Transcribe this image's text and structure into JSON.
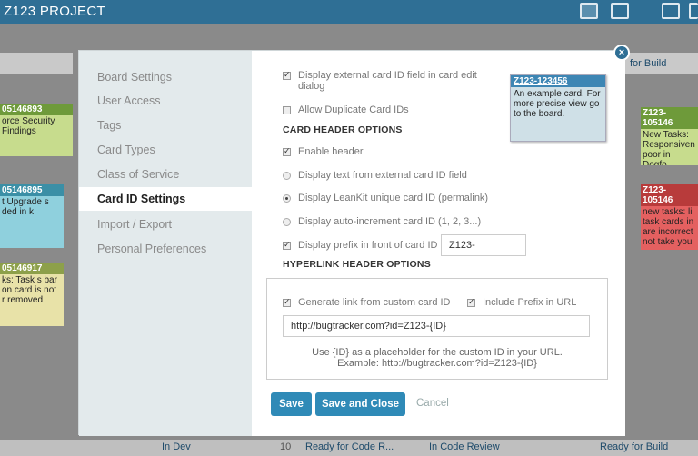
{
  "app": {
    "title": "Z123 PROJECT"
  },
  "board": {
    "lanes_top": [
      "for Build"
    ],
    "cards_left": [
      {
        "id": "05146893",
        "text": "orce Security Findings"
      },
      {
        "id": "05146895",
        "text": "t Upgrade s ded in k"
      },
      {
        "id": "05146917",
        "text": "ks: Task s bar on card is not r removed"
      }
    ],
    "cards_right": [
      {
        "id": "Z123-105146",
        "text": "New Tasks: Responsiven poor in Dogfo"
      },
      {
        "id": "Z123-105146",
        "text": "new tasks: li task cards in are incorrect not take you"
      }
    ],
    "bottom_lanes": [
      "In Dev",
      "10",
      "Ready for Code R...",
      "In Code Review",
      "Ready for Build"
    ],
    "colors": {
      "topbar": "#2f6f95",
      "card_green": "#c7dc8d",
      "card_blue": "#8fd0dd",
      "card_yellow": "#e8e2a8",
      "card_red": "#e46060"
    }
  },
  "modal": {
    "sidebar": [
      {
        "label": "Board Settings"
      },
      {
        "label": "User Access"
      },
      {
        "label": "Tags"
      },
      {
        "label": "Card Types"
      },
      {
        "label": "Class of Service"
      },
      {
        "label": "Card ID Settings",
        "active": true
      },
      {
        "label": "Import / Export"
      },
      {
        "label": "Personal Preferences"
      }
    ],
    "options": {
      "display_external": {
        "label": "Display external card ID field in card edit dialog",
        "checked": true
      },
      "allow_duplicate": {
        "label": "Allow Duplicate Card IDs",
        "checked": false
      }
    },
    "card_header": {
      "heading": "CARD HEADER OPTIONS",
      "enable_header": {
        "label": "Enable header",
        "checked": true
      },
      "radio_external": "Display text from external card ID field",
      "radio_unique": "Display LeanKit unique card ID (permalink)",
      "radio_increment": "Display auto-increment card ID (1, 2, 3...)",
      "selected_radio": "radio_unique",
      "prefix": {
        "label": "Display prefix in front of card ID",
        "checked": true,
        "value": "Z123-"
      }
    },
    "sample_card": {
      "id": "Z123-123456",
      "text": "An example card. For more precise view go to the board."
    },
    "hyperlink": {
      "heading": "HYPERLINK HEADER OPTIONS",
      "generate": {
        "label": "Generate link from custom card ID",
        "checked": true
      },
      "include_prefix": {
        "label": "Include Prefix in URL",
        "checked": true
      },
      "url": "http://bugtracker.com?id=Z123-{ID}",
      "hint1": "Use {ID} as a placeholder for the custom ID in your URL.",
      "hint2": "Example: http://bugtracker.com?id=Z123-{ID}"
    },
    "buttons": {
      "save": "Save",
      "save_close": "Save and Close",
      "cancel": "Cancel"
    },
    "close_glyph": "×"
  }
}
